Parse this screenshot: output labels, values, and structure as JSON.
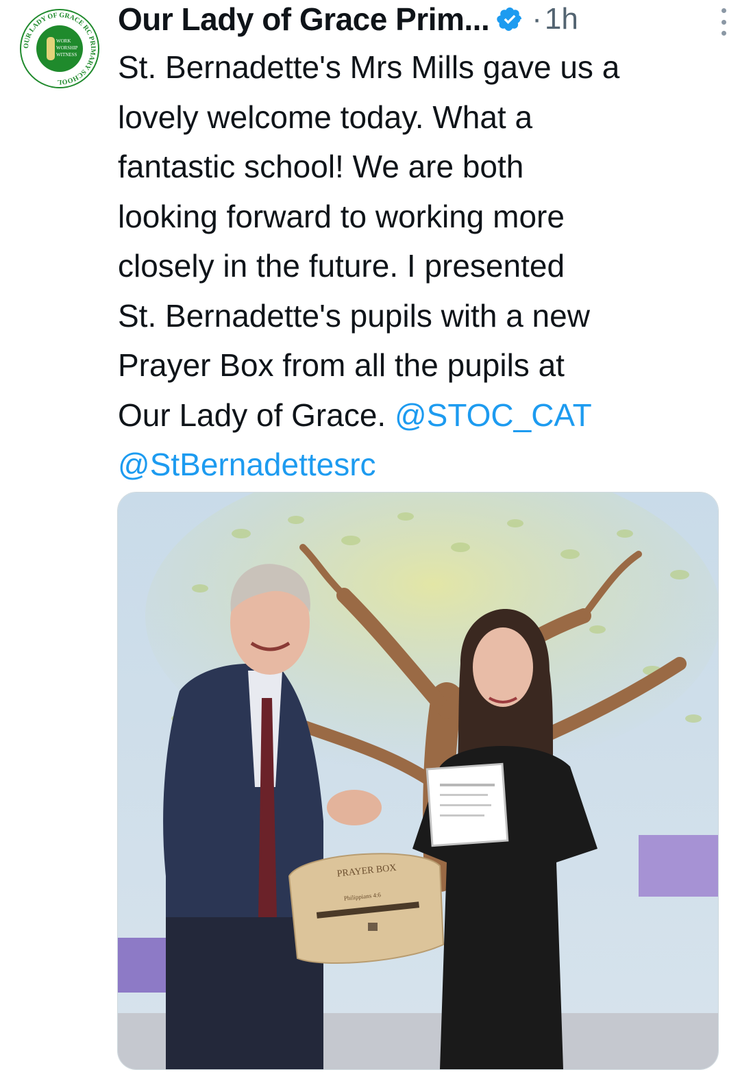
{
  "tweet": {
    "author_name": "Our Lady of Grace Prim...",
    "separator": "·",
    "time": "1h",
    "text_lines": [
      "St. Bernadette's Mrs Mills gave us a",
      "lovely welcome today. What a",
      "fantastic school! We are both",
      "looking forward to working more",
      "closely in the future. I presented",
      "St. Bernadette's pupils with a new",
      "Prayer Box from all the pupils at",
      "Our Lady of Grace. "
    ],
    "mentions": [
      "@STOC_CAT",
      "@StBernadettesrc"
    ]
  },
  "avatar": {
    "ring_text": "OUR LADY OF GRACE RC PRIMARY SCHOOL",
    "motto": [
      "WORK",
      "WORSHIP",
      "WITNESS"
    ]
  },
  "photo": {
    "box_title": "PRAYER BOX",
    "box_verse": "Philippians 4:6"
  },
  "icons": {
    "verified": "verified-badge-icon",
    "more": "more-vertical-icon"
  },
  "colors": {
    "link": "#1d9bf0",
    "verified": "#1d9bf0",
    "muted": "#536471",
    "avatar_green": "#1f8a2c"
  }
}
